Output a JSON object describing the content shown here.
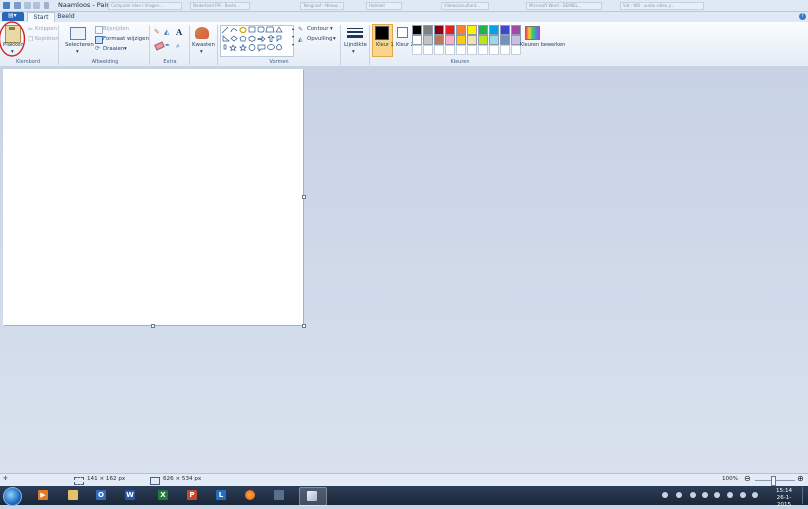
{
  "window": {
    "title": "Naamloos - Paint"
  },
  "background_tabs": [
    "Computer Idee / Vragen...",
    "Nederland FM - Beste...",
    "Telegraaf - Nieuw...",
    "Hotmail",
    "Videoconsultant...",
    "Microsoft Word - DEMIEL...",
    "Vid - WB - audio video y..."
  ],
  "tabs": {
    "file_label": "",
    "start": "Start",
    "view": "Beeld"
  },
  "help_glyph": "?",
  "ribbon": {
    "clipboard": {
      "paste": "Plakken",
      "cut": "Knippen",
      "copy": "Kopiëren",
      "group": "Klembord"
    },
    "image": {
      "select": "Selecteren",
      "crop": "Bijsnijden",
      "resize": "Formaat wijzigen",
      "rotate": "Draaien",
      "group": "Afbeelding"
    },
    "tools": {
      "group": "Extra",
      "text_glyph": "A"
    },
    "brushes": {
      "label": "Kwasten"
    },
    "shapes": {
      "outline": "Contour",
      "fill": "Opvulling",
      "group": "Vormen"
    },
    "size": {
      "label": "Lijndikte"
    },
    "colors": {
      "color1_label": "Kleur 1",
      "color2_label": "Kleur 2",
      "edit_colors": "Kleuren bewerken",
      "group": "Kleuren",
      "color1": "#000000",
      "color2": "#ffffff",
      "palette_row1": [
        "#000000",
        "#7f7f7f",
        "#880015",
        "#ed1c24",
        "#ff7f27",
        "#fff200",
        "#22b14c",
        "#00a2e8",
        "#3f48cc",
        "#a349a4"
      ],
      "palette_row2": [
        "#ffffff",
        "#c3c3c3",
        "#b97a57",
        "#ffaec9",
        "#ffc90e",
        "#efe4b0",
        "#b5e61d",
        "#99d9ea",
        "#7092be",
        "#c8bfe7"
      ],
      "palette_row3": [
        "#ffffff",
        "#ffffff",
        "#ffffff",
        "#ffffff",
        "#ffffff",
        "#ffffff",
        "#ffffff",
        "#ffffff",
        "#ffffff",
        "#ffffff"
      ]
    }
  },
  "status": {
    "selection_size": "141 × 162 px",
    "canvas_size": "626 × 534 px",
    "zoom": "100%"
  },
  "taskbar": {
    "clock_time": "15:14",
    "clock_date": "26-1-2015"
  },
  "accent": "#d62020"
}
